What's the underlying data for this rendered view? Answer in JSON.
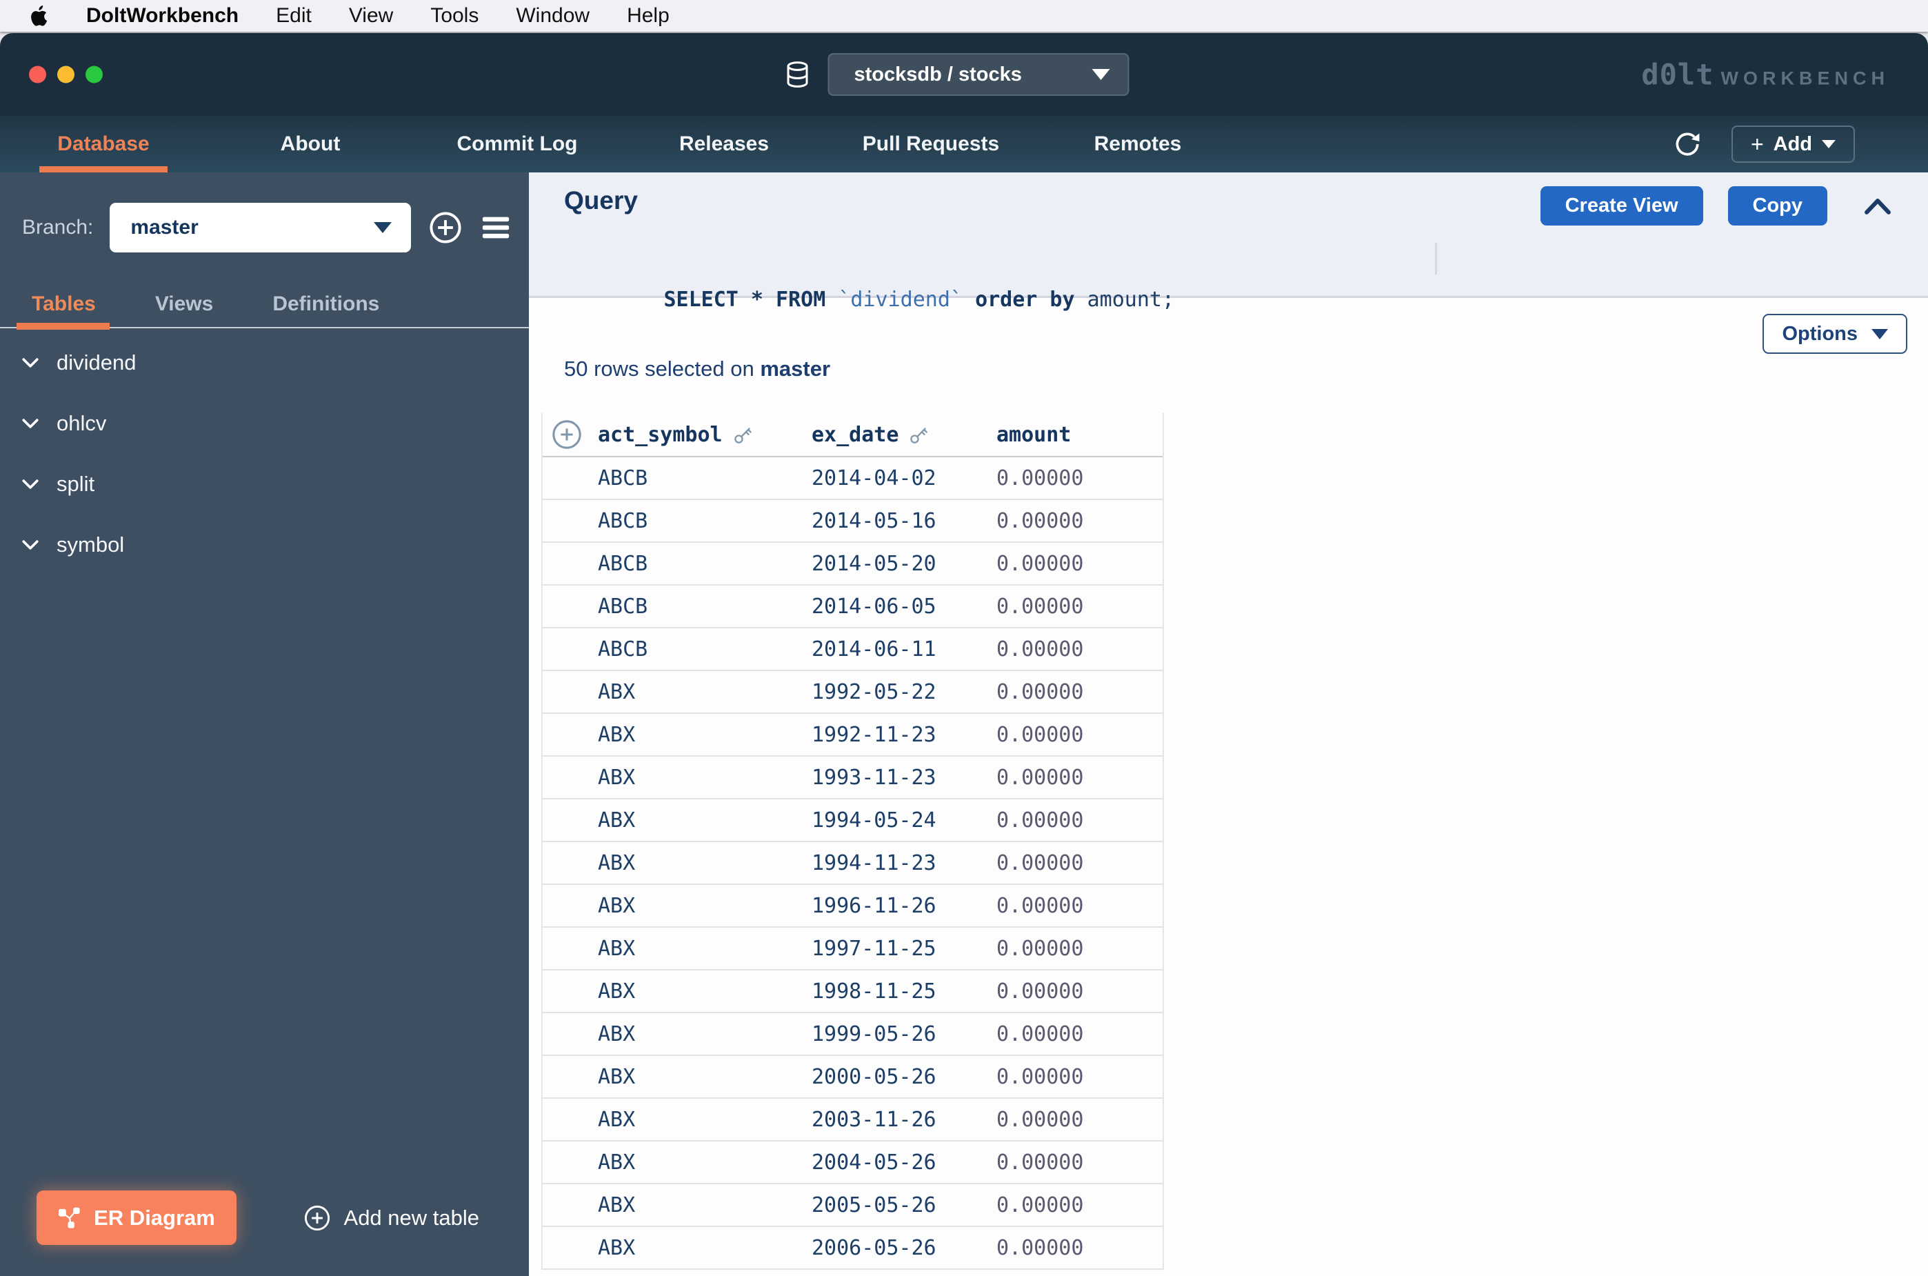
{
  "menu_bar": {
    "app": "DoltWorkbench",
    "items": [
      "Edit",
      "View",
      "Tools",
      "Window",
      "Help"
    ]
  },
  "title_bar": {
    "database_selector": "stocksdb / stocks",
    "logo_dolt": "d0lt",
    "logo_workbench": "WORKBENCH"
  },
  "nav": {
    "tabs": [
      {
        "label": "Database",
        "active": true
      },
      {
        "label": "About",
        "active": false
      },
      {
        "label": "Commit Log",
        "active": false
      },
      {
        "label": "Releases",
        "active": false
      },
      {
        "label": "Pull Requests",
        "active": false
      },
      {
        "label": "Remotes",
        "active": false
      }
    ],
    "add_button": "Add"
  },
  "sidebar": {
    "branch_label": "Branch:",
    "branch_value": "master",
    "tabs": [
      {
        "label": "Tables",
        "active": true
      },
      {
        "label": "Views",
        "active": false
      },
      {
        "label": "Definitions",
        "active": false
      }
    ],
    "tables": [
      "dividend",
      "ohlcv",
      "split",
      "symbol"
    ],
    "er_diagram_button": "ER Diagram",
    "add_new_table": "Add new table"
  },
  "query_panel": {
    "title": "Query",
    "sql_parts": [
      {
        "text": "SELECT * FROM ",
        "style": "kw"
      },
      {
        "text": "`dividend`",
        "style": "id"
      },
      {
        "text": " ",
        "style": "plain"
      },
      {
        "text": "order by",
        "style": "kw"
      },
      {
        "text": " amount;",
        "style": "plain"
      }
    ],
    "create_view_button": "Create View",
    "copy_button": "Copy"
  },
  "results": {
    "options_button": "Options",
    "status_prefix": "50 rows selected on ",
    "status_branch": "master",
    "table": {
      "columns": [
        {
          "name": "act_symbol",
          "key": true
        },
        {
          "name": "ex_date",
          "key": true
        },
        {
          "name": "amount",
          "key": false
        }
      ],
      "rows": [
        [
          "ABCB",
          "2014-04-02",
          "0.00000"
        ],
        [
          "ABCB",
          "2014-05-16",
          "0.00000"
        ],
        [
          "ABCB",
          "2014-05-20",
          "0.00000"
        ],
        [
          "ABCB",
          "2014-06-05",
          "0.00000"
        ],
        [
          "ABCB",
          "2014-06-11",
          "0.00000"
        ],
        [
          "ABX",
          "1992-05-22",
          "0.00000"
        ],
        [
          "ABX",
          "1992-11-23",
          "0.00000"
        ],
        [
          "ABX",
          "1993-11-23",
          "0.00000"
        ],
        [
          "ABX",
          "1994-05-24",
          "0.00000"
        ],
        [
          "ABX",
          "1994-11-23",
          "0.00000"
        ],
        [
          "ABX",
          "1996-11-26",
          "0.00000"
        ],
        [
          "ABX",
          "1997-11-25",
          "0.00000"
        ],
        [
          "ABX",
          "1998-11-25",
          "0.00000"
        ],
        [
          "ABX",
          "1999-05-26",
          "0.00000"
        ],
        [
          "ABX",
          "2000-05-26",
          "0.00000"
        ],
        [
          "ABX",
          "2003-11-26",
          "0.00000"
        ],
        [
          "ABX",
          "2004-05-26",
          "0.00000"
        ],
        [
          "ABX",
          "2005-05-26",
          "0.00000"
        ],
        [
          "ABX",
          "2006-05-26",
          "0.00000"
        ]
      ]
    }
  },
  "colors": {
    "accent_orange": "#ef8257",
    "button_blue": "#2268c4",
    "navy_text": "#16375f",
    "salmon_button": "#f9825e",
    "titlebar": "#1c2e3d",
    "sidebar": "#3d4f61"
  }
}
